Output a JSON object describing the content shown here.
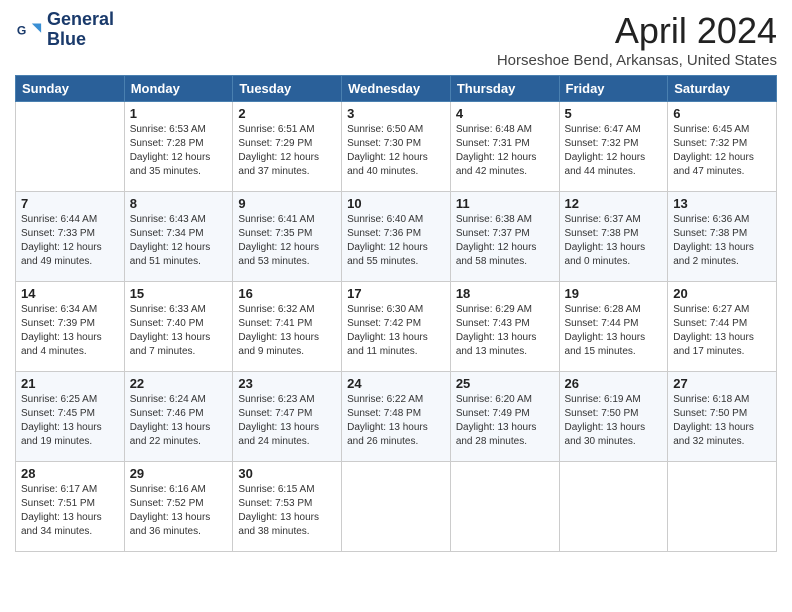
{
  "header": {
    "logo_line1": "General",
    "logo_line2": "Blue",
    "month_title": "April 2024",
    "location": "Horseshoe Bend, Arkansas, United States"
  },
  "days_of_week": [
    "Sunday",
    "Monday",
    "Tuesday",
    "Wednesday",
    "Thursday",
    "Friday",
    "Saturday"
  ],
  "weeks": [
    [
      {
        "day": "",
        "info": ""
      },
      {
        "day": "1",
        "info": "Sunrise: 6:53 AM\nSunset: 7:28 PM\nDaylight: 12 hours\nand 35 minutes."
      },
      {
        "day": "2",
        "info": "Sunrise: 6:51 AM\nSunset: 7:29 PM\nDaylight: 12 hours\nand 37 minutes."
      },
      {
        "day": "3",
        "info": "Sunrise: 6:50 AM\nSunset: 7:30 PM\nDaylight: 12 hours\nand 40 minutes."
      },
      {
        "day": "4",
        "info": "Sunrise: 6:48 AM\nSunset: 7:31 PM\nDaylight: 12 hours\nand 42 minutes."
      },
      {
        "day": "5",
        "info": "Sunrise: 6:47 AM\nSunset: 7:32 PM\nDaylight: 12 hours\nand 44 minutes."
      },
      {
        "day": "6",
        "info": "Sunrise: 6:45 AM\nSunset: 7:32 PM\nDaylight: 12 hours\nand 47 minutes."
      }
    ],
    [
      {
        "day": "7",
        "info": "Sunrise: 6:44 AM\nSunset: 7:33 PM\nDaylight: 12 hours\nand 49 minutes."
      },
      {
        "day": "8",
        "info": "Sunrise: 6:43 AM\nSunset: 7:34 PM\nDaylight: 12 hours\nand 51 minutes."
      },
      {
        "day": "9",
        "info": "Sunrise: 6:41 AM\nSunset: 7:35 PM\nDaylight: 12 hours\nand 53 minutes."
      },
      {
        "day": "10",
        "info": "Sunrise: 6:40 AM\nSunset: 7:36 PM\nDaylight: 12 hours\nand 55 minutes."
      },
      {
        "day": "11",
        "info": "Sunrise: 6:38 AM\nSunset: 7:37 PM\nDaylight: 12 hours\nand 58 minutes."
      },
      {
        "day": "12",
        "info": "Sunrise: 6:37 AM\nSunset: 7:38 PM\nDaylight: 13 hours\nand 0 minutes."
      },
      {
        "day": "13",
        "info": "Sunrise: 6:36 AM\nSunset: 7:38 PM\nDaylight: 13 hours\nand 2 minutes."
      }
    ],
    [
      {
        "day": "14",
        "info": "Sunrise: 6:34 AM\nSunset: 7:39 PM\nDaylight: 13 hours\nand 4 minutes."
      },
      {
        "day": "15",
        "info": "Sunrise: 6:33 AM\nSunset: 7:40 PM\nDaylight: 13 hours\nand 7 minutes."
      },
      {
        "day": "16",
        "info": "Sunrise: 6:32 AM\nSunset: 7:41 PM\nDaylight: 13 hours\nand 9 minutes."
      },
      {
        "day": "17",
        "info": "Sunrise: 6:30 AM\nSunset: 7:42 PM\nDaylight: 13 hours\nand 11 minutes."
      },
      {
        "day": "18",
        "info": "Sunrise: 6:29 AM\nSunset: 7:43 PM\nDaylight: 13 hours\nand 13 minutes."
      },
      {
        "day": "19",
        "info": "Sunrise: 6:28 AM\nSunset: 7:44 PM\nDaylight: 13 hours\nand 15 minutes."
      },
      {
        "day": "20",
        "info": "Sunrise: 6:27 AM\nSunset: 7:44 PM\nDaylight: 13 hours\nand 17 minutes."
      }
    ],
    [
      {
        "day": "21",
        "info": "Sunrise: 6:25 AM\nSunset: 7:45 PM\nDaylight: 13 hours\nand 19 minutes."
      },
      {
        "day": "22",
        "info": "Sunrise: 6:24 AM\nSunset: 7:46 PM\nDaylight: 13 hours\nand 22 minutes."
      },
      {
        "day": "23",
        "info": "Sunrise: 6:23 AM\nSunset: 7:47 PM\nDaylight: 13 hours\nand 24 minutes."
      },
      {
        "day": "24",
        "info": "Sunrise: 6:22 AM\nSunset: 7:48 PM\nDaylight: 13 hours\nand 26 minutes."
      },
      {
        "day": "25",
        "info": "Sunrise: 6:20 AM\nSunset: 7:49 PM\nDaylight: 13 hours\nand 28 minutes."
      },
      {
        "day": "26",
        "info": "Sunrise: 6:19 AM\nSunset: 7:50 PM\nDaylight: 13 hours\nand 30 minutes."
      },
      {
        "day": "27",
        "info": "Sunrise: 6:18 AM\nSunset: 7:50 PM\nDaylight: 13 hours\nand 32 minutes."
      }
    ],
    [
      {
        "day": "28",
        "info": "Sunrise: 6:17 AM\nSunset: 7:51 PM\nDaylight: 13 hours\nand 34 minutes."
      },
      {
        "day": "29",
        "info": "Sunrise: 6:16 AM\nSunset: 7:52 PM\nDaylight: 13 hours\nand 36 minutes."
      },
      {
        "day": "30",
        "info": "Sunrise: 6:15 AM\nSunset: 7:53 PM\nDaylight: 13 hours\nand 38 minutes."
      },
      {
        "day": "",
        "info": ""
      },
      {
        "day": "",
        "info": ""
      },
      {
        "day": "",
        "info": ""
      },
      {
        "day": "",
        "info": ""
      }
    ]
  ]
}
